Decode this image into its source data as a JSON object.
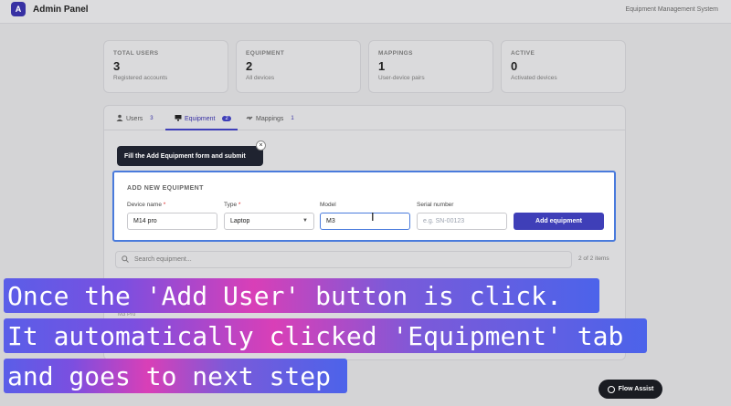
{
  "header": {
    "logo_letter": "A",
    "title": "Admin Panel",
    "subtitle": "Equipment Management System"
  },
  "stats": [
    {
      "label": "TOTAL USERS",
      "value": "3",
      "sub": "Registered accounts"
    },
    {
      "label": "EQUIPMENT",
      "value": "2",
      "sub": "All devices"
    },
    {
      "label": "MAPPINGS",
      "value": "1",
      "sub": "User-device pairs"
    },
    {
      "label": "ACTIVE",
      "value": "0",
      "sub": "Activated devices"
    }
  ],
  "tabs": [
    {
      "icon": "user-icon",
      "label": "Users",
      "count": "3",
      "active": false
    },
    {
      "icon": "monitor-icon",
      "label": "Equipment",
      "count": "2",
      "active": true
    },
    {
      "icon": "link-icon",
      "label": "Mappings",
      "count": "1",
      "active": false
    }
  ],
  "tooltip": {
    "text": "Fill the Add Equipment form and submit",
    "close": "×"
  },
  "form": {
    "title": "ADD NEW EQUIPMENT",
    "device_name": {
      "label": "Device name",
      "required": "*",
      "value": "M14 pro"
    },
    "type": {
      "label": "Type",
      "required": "*",
      "value": "Laptop"
    },
    "model": {
      "label": "Model",
      "value": "M3"
    },
    "serial": {
      "label": "Serial number",
      "placeholder": "e.g. SN-00123"
    },
    "submit": "Add equipment"
  },
  "search": {
    "placeholder": "Search equipment...",
    "count": "2 of 2 items"
  },
  "list_preview": "M3 Pro",
  "captions": [
    "Once the 'Add User' button is click.",
    "It automatically clicked 'Equipment' tab",
    "and goes to next step"
  ],
  "flow_assist": "Flow Assist",
  "colors": {
    "accent": "#3f3fb8",
    "focus": "#4a7bdc",
    "required": "#dc2626"
  }
}
